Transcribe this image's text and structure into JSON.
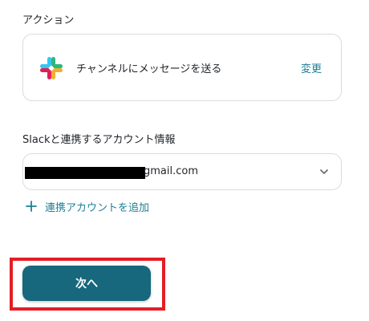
{
  "action_section": {
    "label": "アクション",
    "action_text": "チャンネルにメッセージを送る",
    "change_label": "変更",
    "icon": "slack-logo"
  },
  "account_section": {
    "label": "Slackと連携するアカウント情報",
    "selected_value": "gmail.com",
    "redacted": true,
    "dropdown_icon": "chevron-down-icon"
  },
  "add_account": {
    "icon": "plus-icon",
    "label": "連携アカウントを追加"
  },
  "footer": {
    "next_label": "次へ"
  },
  "colors": {
    "accent": "#1d7f95",
    "button_bg": "#17677d",
    "highlight": "#e31e24",
    "border": "#d9dcdf"
  }
}
